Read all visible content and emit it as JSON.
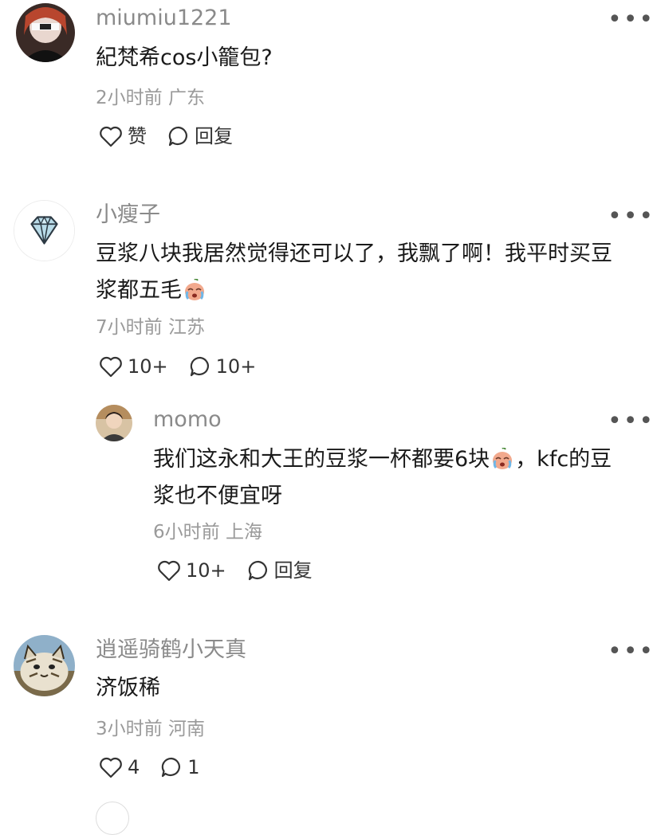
{
  "comments": [
    {
      "user": "miumiu1221",
      "line1": "紀梵希cos小籠包?",
      "time": "2小时前",
      "location": "广东",
      "like_label": "赞",
      "reply_label": "回复"
    },
    {
      "user": "小瘦子",
      "line1": "豆浆八块我居然觉得还可以了，我飘了啊！我平时买豆",
      "line2": "浆都五毛",
      "time": "7小时前",
      "location": "江苏",
      "like_label": "10+",
      "reply_label": "10+"
    },
    {
      "user": "momo",
      "line1a": "我们这永和大王的豆浆一杯都要6块",
      "line1b": "，kfc的豆",
      "line2": "浆也不便宜呀",
      "time": "6小时前",
      "location": "上海",
      "like_label": "10+",
      "reply_label": "回复"
    },
    {
      "user": "逍遥骑鹤小天真",
      "line1": "济饭稀",
      "time": "3小时前",
      "location": "河南",
      "like_label": "4",
      "reply_label": "1"
    }
  ],
  "more_label": "•••",
  "icons": {
    "like": "heart-outline-icon",
    "reply": "speech-bubble-icon",
    "more": "more-dots-icon",
    "emoji": "crying-face-emoji"
  },
  "colors": {
    "username": "#8a8a8a",
    "meta": "#9a9a9a",
    "text": "#1a1a1a"
  }
}
